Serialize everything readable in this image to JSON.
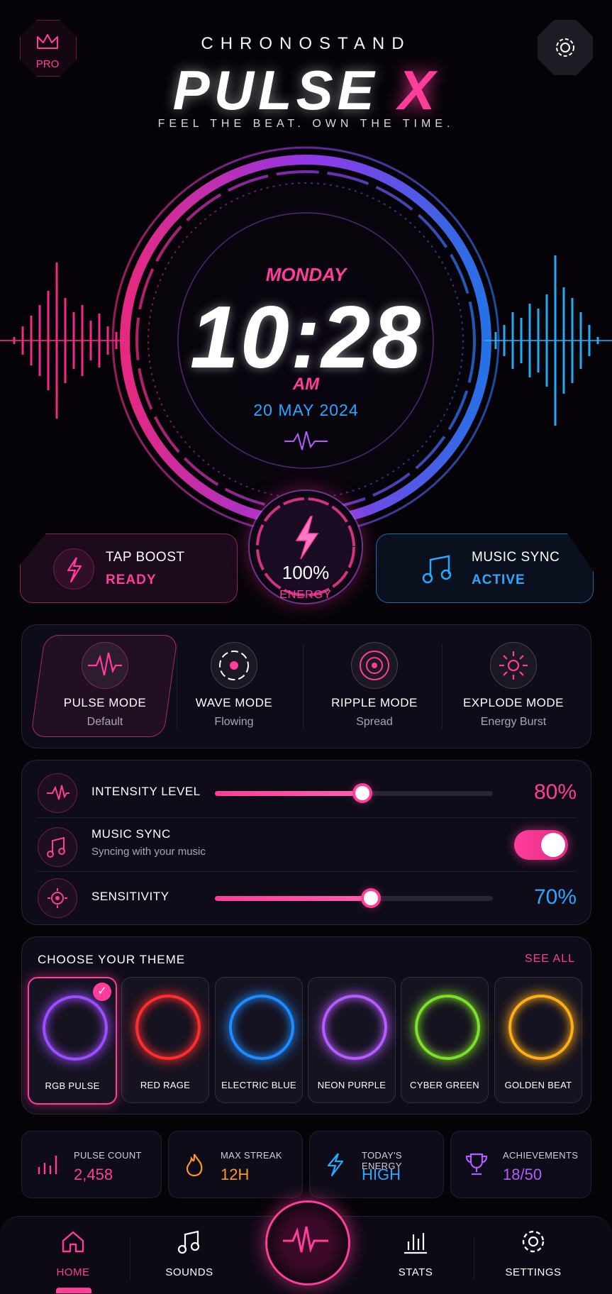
{
  "header": {
    "pro_label": "PRO",
    "brand": "CHRONOSTAND",
    "logo_main": "PULSE",
    "logo_accent": "X",
    "tagline": "FEEL THE BEAT. OWN THE TIME."
  },
  "clock": {
    "day": "MONDAY",
    "time": "10:28",
    "ampm": "AM",
    "date": "20 MAY 2024"
  },
  "boost": {
    "tap_title": "TAP BOOST",
    "tap_status": "READY",
    "energy_value": "100%",
    "energy_label": "ENERGY",
    "music_title": "MUSIC SYNC",
    "music_status": "ACTIVE"
  },
  "modes": [
    {
      "title": "PULSE MODE",
      "sub": "Default",
      "active": true
    },
    {
      "title": "WAVE MODE",
      "sub": "Flowing",
      "active": false
    },
    {
      "title": "RIPPLE MODE",
      "sub": "Spread",
      "active": false
    },
    {
      "title": "EXPLODE MODE",
      "sub": "Energy Burst",
      "active": false
    }
  ],
  "controls": {
    "intensity_label": "INTENSITY LEVEL",
    "intensity_value": "80%",
    "intensity_level": 0.53,
    "music_sync_label": "MUSIC SYNC",
    "music_sync_sub": "Syncing with your music",
    "music_sync_on": true,
    "sensitivity_label": "SENSITIVITY",
    "sensitivity_value": "70%",
    "sensitivity_level": 0.56
  },
  "themes": {
    "title": "CHOOSE YOUR THEME",
    "see_all": "SEE ALL",
    "items": [
      {
        "name": "RGB PULSE",
        "color": "#9b4dff",
        "selected": true
      },
      {
        "name": "RED RAGE",
        "color": "#ff2e2e",
        "selected": false
      },
      {
        "name": "ELECTRIC BLUE",
        "color": "#1e8bff",
        "selected": false
      },
      {
        "name": "NEON PURPLE",
        "color": "#b45cff",
        "selected": false
      },
      {
        "name": "CYBER GREEN",
        "color": "#7ee02a",
        "selected": false
      },
      {
        "name": "GOLDEN BEAT",
        "color": "#ffae1a",
        "selected": false
      }
    ]
  },
  "stats": [
    {
      "label": "PULSE COUNT",
      "value": "2,458",
      "color": "#ff3d9a",
      "icon": "bar-chart-icon"
    },
    {
      "label": "MAX STREAK",
      "value": "12H",
      "color": "#ff9a1f",
      "icon": "flame-icon"
    },
    {
      "label": "TODAY'S ENERGY",
      "value": "HIGH",
      "color": "#2aa8ff",
      "icon": "bolt-icon"
    },
    {
      "label": "ACHIEVEMENTS",
      "value": "18/50",
      "color": "#b45cff",
      "icon": "trophy-icon"
    }
  ],
  "nav": {
    "home": "HOME",
    "sounds": "SOUNDS",
    "stats": "STATS",
    "settings": "SETTINGS"
  },
  "colors": {
    "accent_pink": "#ff3d9a",
    "accent_blue": "#2aa8ff",
    "background": "#050308"
  }
}
